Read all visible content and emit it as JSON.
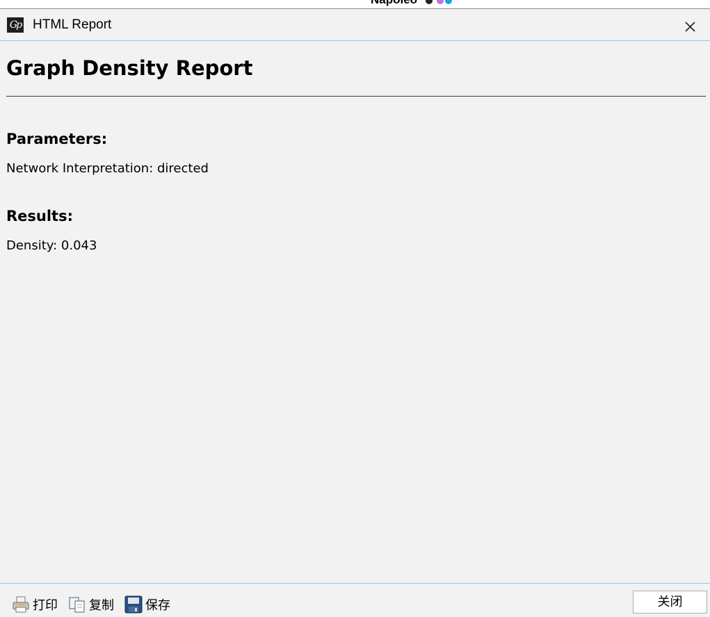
{
  "background": {
    "partial_title": "Napoleo"
  },
  "window": {
    "title": "HTML Report",
    "icon": "gephi-logo-icon"
  },
  "report": {
    "title": "Graph Density Report",
    "parameters_heading": "Parameters:",
    "parameters_text": "Network Interpretation: directed",
    "results_heading": "Results:",
    "results_text": "Density: 0.043"
  },
  "toolbar": {
    "print_label": "打印",
    "copy_label": "复制",
    "save_label": "保存",
    "close_label": "关闭"
  },
  "colors": {
    "window_bg": "#f2f2f2",
    "accent_border": "#9cc3e6",
    "save_icon": "#2b4f7e"
  }
}
